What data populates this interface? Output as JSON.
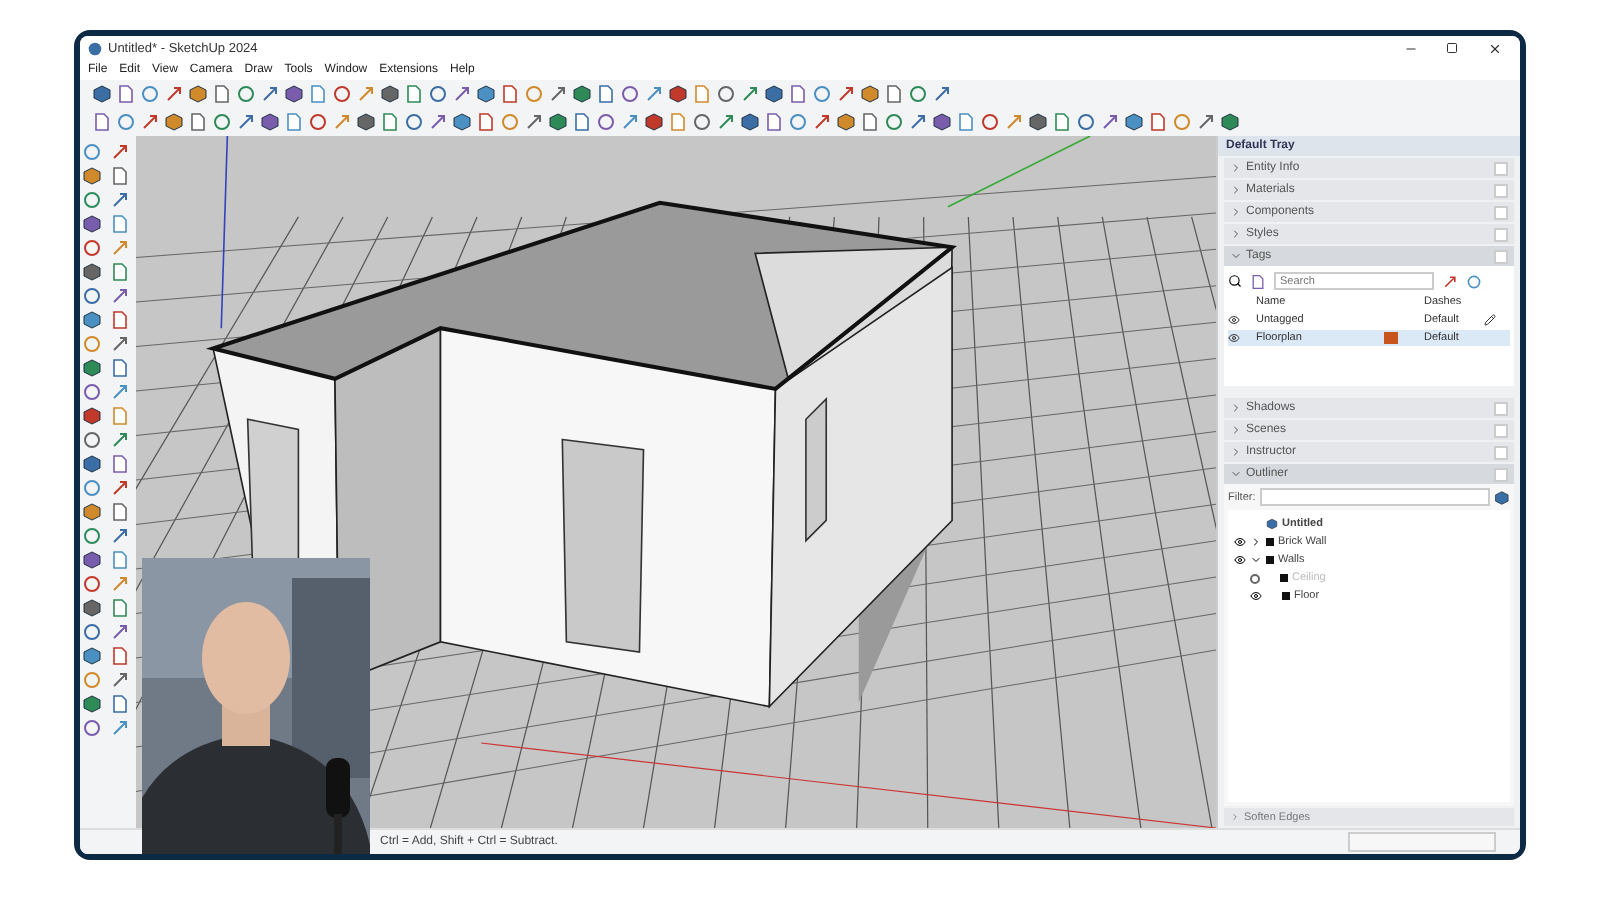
{
  "window": {
    "title": "Untitled* - SketchUp 2024"
  },
  "menu": [
    "File",
    "Edit",
    "View",
    "Camera",
    "Draw",
    "Tools",
    "Window",
    "Extensions",
    "Help"
  ],
  "tray": {
    "title": "Default Tray",
    "panels_top": [
      {
        "label": "Entity Info",
        "expanded": false
      },
      {
        "label": "Materials",
        "expanded": false
      },
      {
        "label": "Components",
        "expanded": false
      },
      {
        "label": "Styles",
        "expanded": false
      },
      {
        "label": "Tags",
        "expanded": true
      }
    ],
    "tags": {
      "search": {
        "placeholder": "Search"
      },
      "columns": [
        "Name",
        "Dashes"
      ],
      "rows": [
        {
          "name": "Untagged",
          "dashes": "Default",
          "selected": false,
          "active": true
        },
        {
          "name": "Floorplan",
          "dashes": "Default",
          "color": "#c8561c",
          "selected": true,
          "active": false
        }
      ]
    },
    "panels_bottom": [
      {
        "label": "Shadows",
        "expanded": false
      },
      {
        "label": "Scenes",
        "expanded": false
      },
      {
        "label": "Instructor",
        "expanded": false
      },
      {
        "label": "Outliner",
        "expanded": true
      }
    ],
    "outliner": {
      "filter_label": "Filter:",
      "root": "Untitled",
      "items": [
        {
          "name": "Brick Wall",
          "visible": true,
          "expanded": false
        },
        {
          "name": "Walls",
          "visible": true,
          "expanded": true,
          "children": [
            {
              "name": "Ceiling",
              "visible": false
            },
            {
              "name": "Floor",
              "visible": true
            }
          ]
        }
      ]
    },
    "collapsed_bottom": "Soften Edges"
  },
  "status_bar": {
    "text": "Ctrl = Add, Shift + Ctrl = Subtract."
  }
}
